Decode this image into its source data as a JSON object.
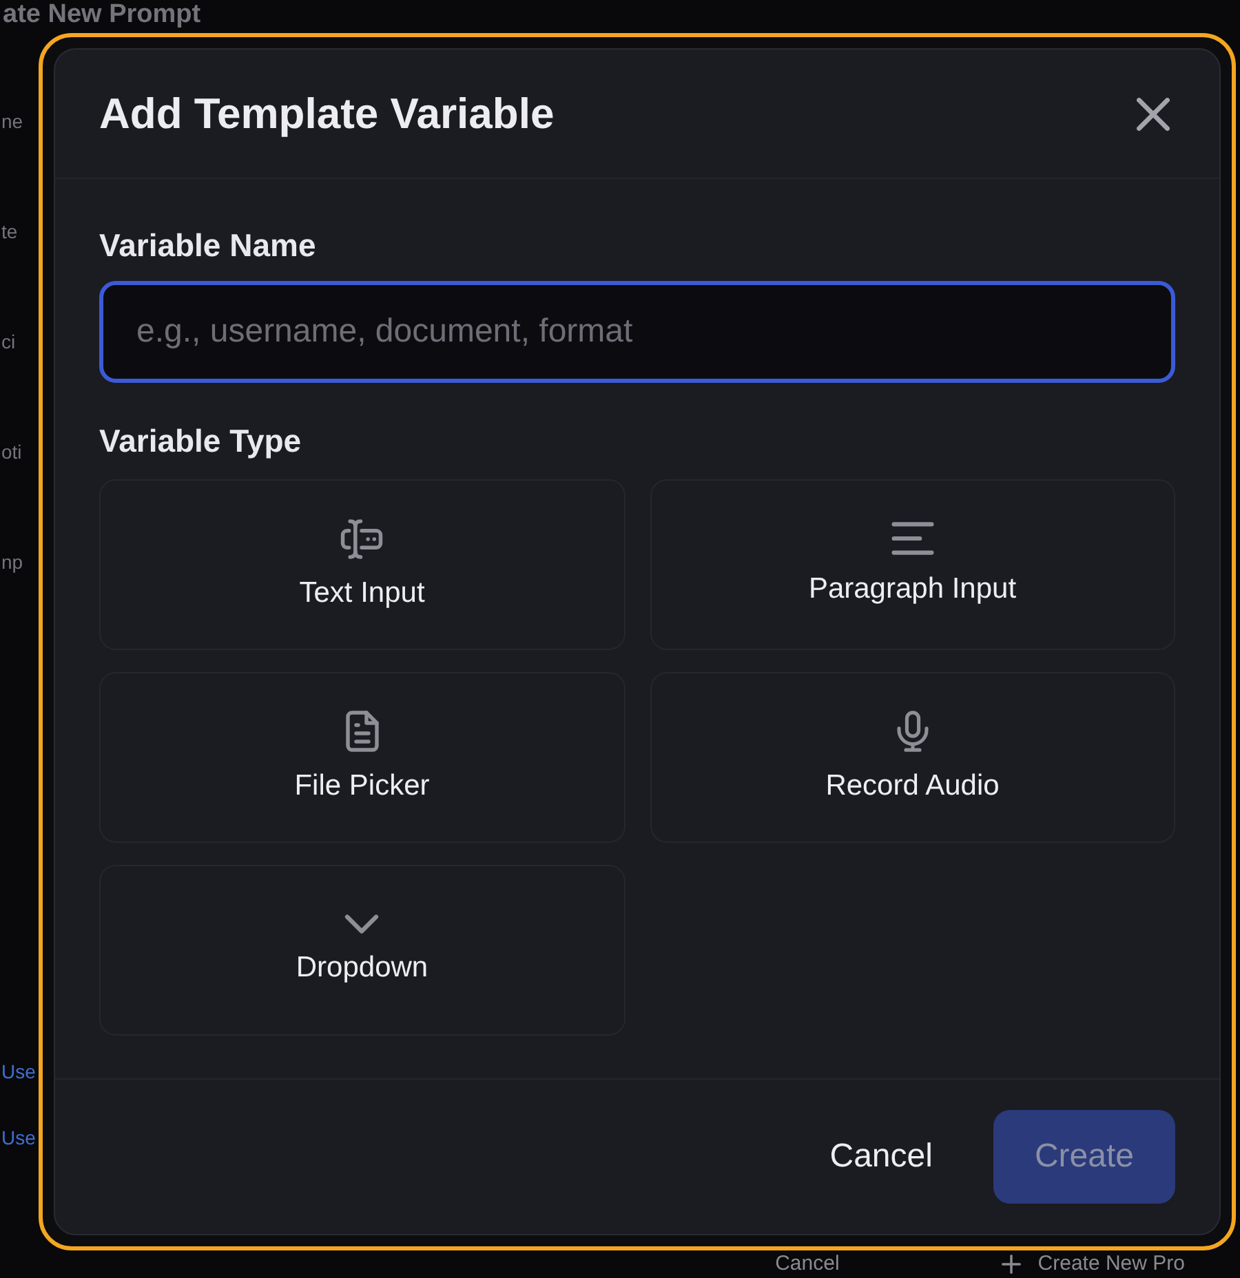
{
  "background": {
    "title": "ate New Prompt",
    "side_items": [
      {
        "kind": "text",
        "text": "ne"
      },
      {
        "kind": "text",
        "text": "te"
      },
      {
        "kind": "text",
        "text": "ci"
      },
      {
        "kind": "text",
        "text": "oti"
      },
      {
        "kind": "text",
        "text": "np"
      },
      {
        "kind": "link",
        "text": "Use"
      },
      {
        "kind": "link",
        "text": "Use"
      }
    ],
    "footer": {
      "cancel_button": "Cancel",
      "create_button": "Create New Pro"
    }
  },
  "dialog": {
    "title": "Add Template Variable",
    "name_field": {
      "label": "Variable Name",
      "placeholder": "e.g., username, document, format",
      "focused": true
    },
    "type_section": {
      "label": "Variable Type",
      "options": [
        {
          "kind": "text",
          "label": "Text Input",
          "selected": false
        },
        {
          "kind": "paragraph",
          "label": "Paragraph Input",
          "selected": false
        },
        {
          "kind": "file",
          "label": "File Picker",
          "selected": false
        },
        {
          "kind": "audio",
          "label": "Record Audio",
          "selected": false
        },
        {
          "kind": "dropdown",
          "label": "Dropdown",
          "selected": false
        }
      ]
    },
    "buttons": [
      {
        "kind": "cancel",
        "label": "Cancel",
        "disabled": false
      },
      {
        "kind": "create",
        "label": "Create",
        "disabled": true
      }
    ]
  }
}
